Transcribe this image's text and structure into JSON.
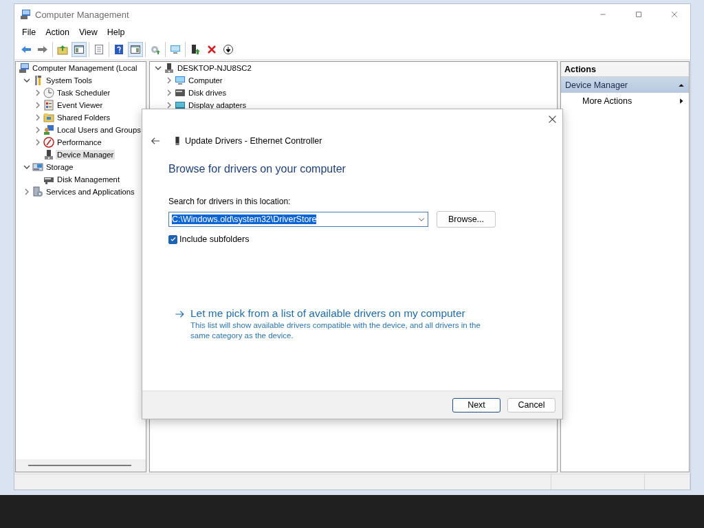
{
  "window": {
    "title": "Computer Management"
  },
  "menu": [
    "File",
    "Action",
    "View",
    "Help"
  ],
  "toolbar": [
    [
      {
        "kind": "back",
        "on": false
      },
      {
        "kind": "forward",
        "on": false
      }
    ],
    [
      {
        "kind": "up-folder",
        "on": false
      },
      {
        "kind": "console-tree",
        "on": true
      }
    ],
    [
      {
        "kind": "properties",
        "on": false
      }
    ],
    [
      {
        "kind": "help",
        "on": false
      },
      {
        "kind": "action-pane",
        "on": true
      }
    ],
    [
      {
        "kind": "export",
        "on": false
      }
    ],
    [
      {
        "kind": "monitor",
        "on": false
      }
    ],
    [
      {
        "kind": "update-driver",
        "on": false
      },
      {
        "kind": "delete",
        "on": false
      },
      {
        "kind": "down",
        "on": false
      }
    ]
  ],
  "sidebar": {
    "items": [
      {
        "label": "Computer Management (Local",
        "kind": "computer",
        "selected": false,
        "children": [
          {
            "label": "System Tools",
            "kind": "tools",
            "expanded": true,
            "selected": false,
            "children": [
              {
                "label": "Task Scheduler",
                "kind": "clock",
                "expanded": false,
                "selected": false
              },
              {
                "label": "Event Viewer",
                "kind": "log",
                "expanded": false,
                "selected": false
              },
              {
                "label": "Shared Folders",
                "kind": "folder",
                "expanded": false,
                "selected": false
              },
              {
                "label": "Local Users and Groups",
                "kind": "users",
                "expanded": false,
                "selected": false
              },
              {
                "label": "Performance",
                "kind": "gauge",
                "expanded": false,
                "selected": false
              },
              {
                "label": "Device Manager",
                "kind": "device",
                "selected": true
              }
            ]
          },
          {
            "label": "Storage",
            "kind": "storage",
            "expanded": true,
            "selected": false,
            "children": [
              {
                "label": "Disk Management",
                "kind": "disk",
                "selected": false
              }
            ]
          },
          {
            "label": "Services and Applications",
            "kind": "services",
            "expanded": false,
            "selected": false
          }
        ]
      }
    ]
  },
  "devices": {
    "items": [
      {
        "label": "DESKTOP-NJU8SC2",
        "kind": "device",
        "expanded": true,
        "children": [
          {
            "label": "Computer",
            "kind": "monitor",
            "expanded": false
          },
          {
            "label": "Disk drives",
            "kind": "drive",
            "expanded": false
          },
          {
            "label": "Display adapters",
            "kind": "adapter",
            "expanded": false
          }
        ]
      }
    ]
  },
  "actions": {
    "title": "Actions",
    "sections": [
      {
        "title": "Device Manager",
        "expanded": true,
        "items": [
          {
            "label": "More Actions",
            "submenu": true
          }
        ]
      }
    ]
  },
  "dialog": {
    "title": "Update Drivers - Ethernet Controller",
    "heading": "Browse for drivers on your computer",
    "location_label": "Search for drivers in this location:",
    "location": {
      "value": "C:\\Windows.old\\system32\\DriverStore",
      "text_selected": true
    },
    "browse_button": "Browse...",
    "include_subfolders": {
      "label": "Include subfolders",
      "checked": true
    },
    "pick_link": {
      "title": "Let me pick from a list of available drivers on my computer",
      "description": "This list will show available drivers compatible with the device, and all drivers in the same category as the device."
    },
    "buttons": [
      {
        "label": "Next",
        "default": true
      },
      {
        "label": "Cancel",
        "default": false
      }
    ]
  }
}
